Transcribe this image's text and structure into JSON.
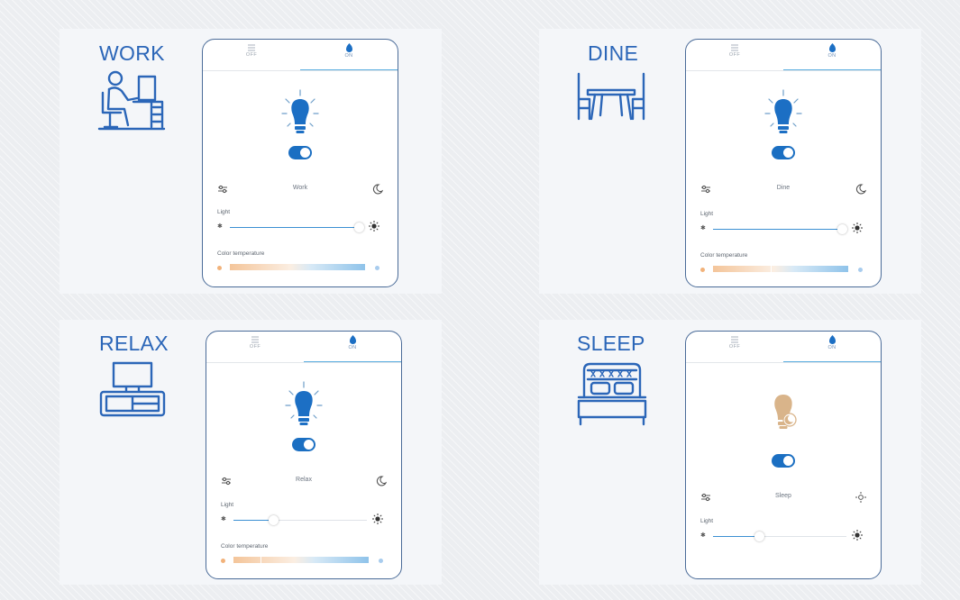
{
  "scenes": [
    {
      "label": "WORK",
      "mode": "Work",
      "tab_off": "OFF",
      "tab_on": "ON",
      "light_label": "Light",
      "color_temp_label": "Color temperature",
      "light_level": 0.97,
      "night_icon": "moon-icon",
      "bulb_color": "#1c6fc4"
    },
    {
      "label": "DINE",
      "mode": "Dine",
      "tab_off": "OFF",
      "tab_on": "ON",
      "light_label": "Light",
      "color_temp_label": "Color temperature",
      "light_level": 0.97,
      "night_icon": "moon-icon",
      "bulb_color": "#1c6fc4"
    },
    {
      "label": "RELAX",
      "mode": "Relax",
      "tab_off": "OFF",
      "tab_on": "ON",
      "light_label": "Light",
      "color_temp_label": "Color temperature",
      "light_level": 0.3,
      "night_icon": "moon-icon",
      "bulb_color": "#1c6fc4"
    },
    {
      "label": "SLEEP",
      "mode": "Sleep",
      "tab_off": "OFF",
      "tab_on": "ON",
      "light_label": "Light",
      "light_level": 0.35,
      "night_icon": "brightness-icon",
      "bulb_color": "#d9b48a"
    }
  ],
  "colors": {
    "accent": "#2b66b8",
    "toggle": "#1b6fc2",
    "slider": "#3b8fd3"
  }
}
